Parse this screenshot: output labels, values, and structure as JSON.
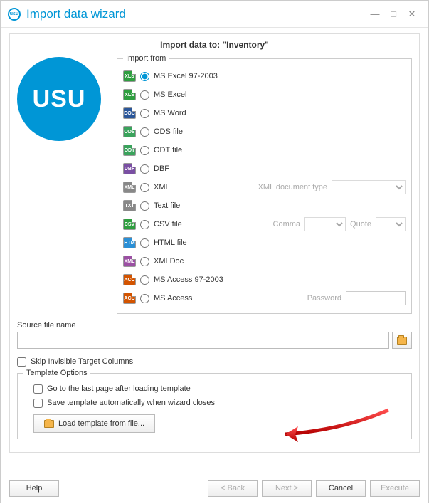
{
  "window": {
    "title": "Import data wizard"
  },
  "panel": {
    "heading": "Import data to: \"Inventory\""
  },
  "importFrom": {
    "legend": "Import from",
    "options": [
      {
        "icon": "XLS",
        "iconClass": "ic-xls",
        "label": "MS Excel 97-2003"
      },
      {
        "icon": "XLS",
        "iconClass": "ic-xlsx",
        "label": "MS Excel"
      },
      {
        "icon": "DOC",
        "iconClass": "ic-doc",
        "label": "MS Word"
      },
      {
        "icon": "ODS",
        "iconClass": "ic-ods",
        "label": "ODS file"
      },
      {
        "icon": "ODT",
        "iconClass": "ic-odt",
        "label": "ODT file"
      },
      {
        "icon": "DBF",
        "iconClass": "ic-dbf",
        "label": "DBF"
      },
      {
        "icon": "XML",
        "iconClass": "ic-xml",
        "label": "XML"
      },
      {
        "icon": "TXT",
        "iconClass": "ic-txt",
        "label": "Text file"
      },
      {
        "icon": "CSV",
        "iconClass": "ic-csv",
        "label": "CSV file"
      },
      {
        "icon": "HTM",
        "iconClass": "ic-html",
        "label": "HTML file"
      },
      {
        "icon": "XML",
        "iconClass": "ic-xmldoc",
        "label": "XMLDoc"
      },
      {
        "icon": "ACC",
        "iconClass": "ic-acc",
        "label": "MS Access 97-2003"
      },
      {
        "icon": "ACC",
        "iconClass": "ic-accx",
        "label": "MS Access"
      }
    ],
    "selectedIndex": 0,
    "xmlTypeLabel": "XML document type",
    "commaLabel": "Comma",
    "quoteLabel": "Quote",
    "passwordLabel": "Password"
  },
  "source": {
    "label": "Source file name",
    "value": ""
  },
  "skipInvisible": {
    "label": "Skip Invisible Target Columns",
    "checked": false
  },
  "template": {
    "legend": "Template Options",
    "opt1": "Go to the last page after loading template",
    "opt2": "Save template automatically when wizard closes",
    "loadBtn": "Load template from file..."
  },
  "footer": {
    "help": "Help",
    "back": "< Back",
    "next": "Next >",
    "cancel": "Cancel",
    "execute": "Execute"
  }
}
